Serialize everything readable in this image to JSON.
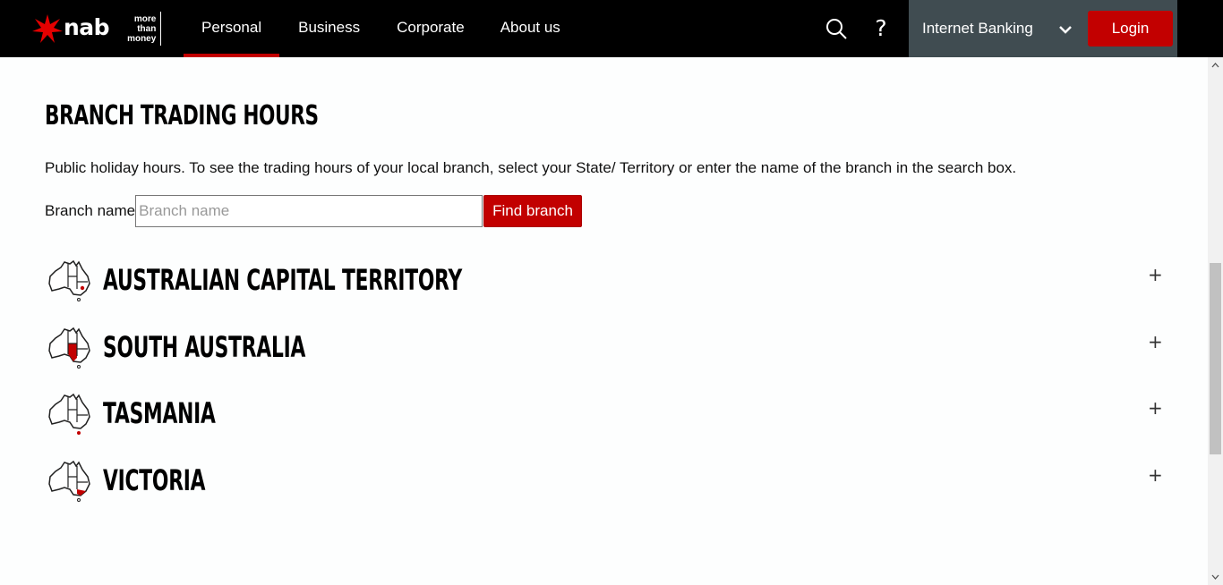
{
  "header": {
    "logo_word": "nab",
    "logo_tagline": [
      "more",
      "than",
      "money"
    ],
    "nav": [
      {
        "label": "Personal",
        "active": true
      },
      {
        "label": "Business",
        "active": false
      },
      {
        "label": "Corporate",
        "active": false
      },
      {
        "label": "About us",
        "active": false
      }
    ],
    "search_icon": "search-icon",
    "help_label": "?",
    "internet_banking_label": "Internet Banking",
    "login_label": "Login"
  },
  "content": {
    "title": "BRANCH TRADING HOURS",
    "intro": "Public holiday hours. To see the trading hours of your local branch, select your State/ Territory or enter the name of the branch in the search box.",
    "search": {
      "label": "Branch name",
      "placeholder": "Branch name",
      "value": "",
      "button_label": "Find branch"
    },
    "states": [
      {
        "name": "AUSTRALIAN CAPITAL TERRITORY",
        "highlight": "act",
        "expand_icon": "+"
      },
      {
        "name": "SOUTH AUSTRALIA",
        "highlight": "sa",
        "expand_icon": "+"
      },
      {
        "name": "TASMANIA",
        "highlight": "tas",
        "expand_icon": "+"
      },
      {
        "name": "VICTORIA",
        "highlight": "vic",
        "expand_icon": "+"
      }
    ]
  },
  "colors": {
    "brand_red": "#c20000",
    "header_bg": "#000000",
    "ib_panel_bg": "#404c51"
  }
}
